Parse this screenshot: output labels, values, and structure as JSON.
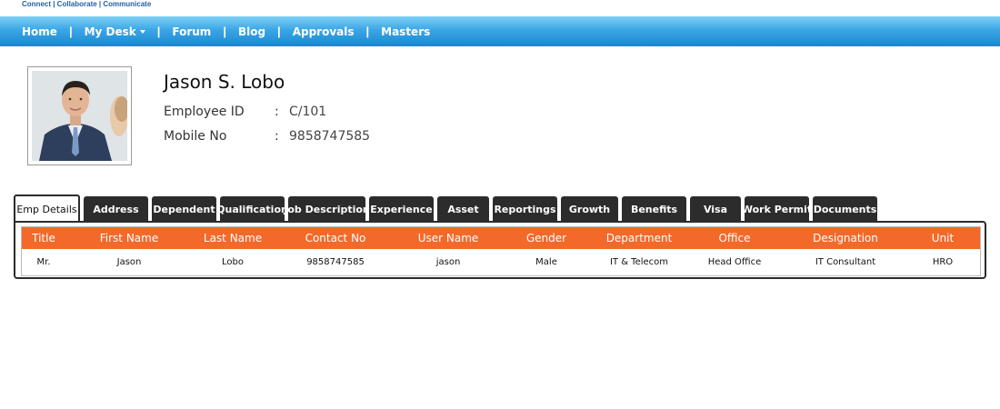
{
  "header": {
    "tagline": "Connect | Collaborate | Communicate"
  },
  "nav": {
    "items": [
      {
        "label": "Home",
        "name": "nav-home",
        "dropdown": false
      },
      {
        "label": "My Desk",
        "name": "nav-my-desk",
        "dropdown": true
      },
      {
        "label": "Forum",
        "name": "nav-forum",
        "dropdown": false
      },
      {
        "label": "Blog",
        "name": "nav-blog",
        "dropdown": false
      },
      {
        "label": "Approvals",
        "name": "nav-approvals",
        "dropdown": false
      },
      {
        "label": "Masters",
        "name": "nav-masters",
        "dropdown": false
      }
    ],
    "separator": "|"
  },
  "profile": {
    "name": "Jason S. Lobo",
    "employee_id_label": "Employee ID",
    "employee_id": "C/101",
    "mobile_label": "Mobile No",
    "mobile": "9858747585",
    "colon": ":"
  },
  "tabs": [
    {
      "label": "Emp Details",
      "active": true
    },
    {
      "label": "Address"
    },
    {
      "label": "Dependent"
    },
    {
      "label": "Qualification"
    },
    {
      "label": "Job Description"
    },
    {
      "label": "Experience"
    },
    {
      "label": "Asset"
    },
    {
      "label": "Reportings"
    },
    {
      "label": "Growth"
    },
    {
      "label": "Benefits"
    },
    {
      "label": "Visa"
    },
    {
      "label": "Work Permit"
    },
    {
      "label": "Documents"
    }
  ],
  "table": {
    "columns": [
      "Title",
      "First Name",
      "Last Name",
      "Contact No",
      "User Name",
      "Gender",
      "Department",
      "Office",
      "Designation",
      "Unit"
    ],
    "rows": [
      [
        "Mr.",
        "Jason",
        "Lobo",
        "9858747585",
        "jason",
        "Male",
        "IT & Telecom",
        "Head Office",
        "IT Consultant",
        "HRO"
      ]
    ]
  },
  "colors": {
    "nav": "#2a97de",
    "header_row": "#f2692a",
    "tab": "#2c2c2c"
  }
}
